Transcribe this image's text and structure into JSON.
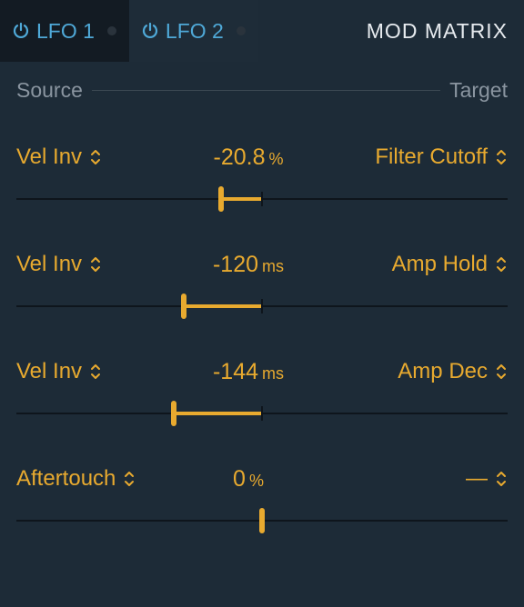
{
  "tabs": {
    "lfo1": "LFO 1",
    "lfo2": "LFO 2",
    "modmatrix": "MOD MATRIX"
  },
  "labels": {
    "source": "Source",
    "target": "Target"
  },
  "colors": {
    "accent": "#e8aa2f",
    "tab_blue": "#4fa9d8"
  },
  "rows": [
    {
      "source": "Vel Inv",
      "value": "-20.8",
      "unit": "%",
      "target": "Filter Cutoff",
      "handle_pct": 41.6,
      "center_pct": 50,
      "fill_from_pct": 41.6,
      "fill_to_pct": 50
    },
    {
      "source": "Vel Inv",
      "value": "-120",
      "unit": "ms",
      "target": "Amp Hold",
      "handle_pct": 34,
      "center_pct": 50,
      "fill_from_pct": 34,
      "fill_to_pct": 50
    },
    {
      "source": "Vel Inv",
      "value": "-144",
      "unit": "ms",
      "target": "Amp Dec",
      "handle_pct": 32,
      "center_pct": 50,
      "fill_from_pct": 32,
      "fill_to_pct": 50
    },
    {
      "source": "Aftertouch",
      "value": "0",
      "unit": "%",
      "target": "—",
      "handle_pct": 50,
      "center_pct": 50,
      "fill_from_pct": 50,
      "fill_to_pct": 50
    }
  ]
}
